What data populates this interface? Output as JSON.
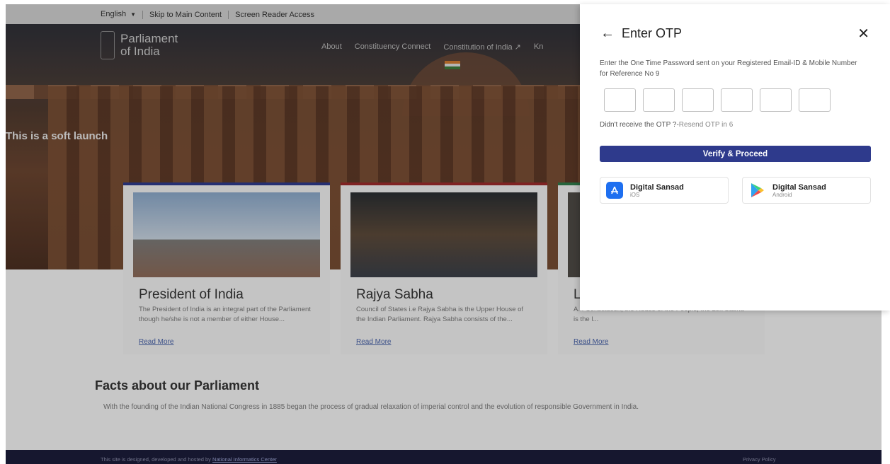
{
  "topbar": {
    "language": "English",
    "skip": "Skip to Main Content",
    "screen_reader": "Screen Reader Access"
  },
  "logo": {
    "line1": "Parliament",
    "line2": "of India"
  },
  "nav": {
    "items": [
      "About",
      "Constituency Connect",
      "Constitution of India",
      "Kn"
    ]
  },
  "hero": {
    "banner": "This is a soft launch"
  },
  "cards": [
    {
      "title": "President of India",
      "desc": "The President of India is an integral part of the Parliament though he/she is not a member of either House...",
      "link": "Read More",
      "accent": "#2e3a8c"
    },
    {
      "title": "Rajya Sabha",
      "desc": "Council of States i.e Rajya Sabha is the Upper House of the Indian Parliament. Rajya Sabha consists of the...",
      "link": "Read More",
      "accent": "#9c2b2b"
    },
    {
      "title": "L",
      "desc": "A... Constitution, the House of the People, the Lok Sabha is the l...",
      "link": "Read More",
      "accent": "#2f7a4a"
    }
  ],
  "facts": {
    "title": "Facts about our Parliament",
    "text": "With the founding of the Indian National Congress in 1885 began the process of gradual relaxation of imperial control and the evolution of responsible Government in India."
  },
  "footer": {
    "left_prefix": "This site is designed, developed and hosted by",
    "left_link": "National Informatics Center",
    "right": "Privacy Policy"
  },
  "modal": {
    "title": "Enter OTP",
    "description": "Enter the One Time Password sent on your Registered Email-ID & Mobile Number for Reference No 9",
    "resend_prefix": "Didn't receive the OTP ?-",
    "resend_timer": "Resend OTP in 6",
    "verify_label": "Verify & Proceed",
    "apps": [
      {
        "name": "Digital Sansad",
        "platform": "iOS",
        "icon": "app-store-icon"
      },
      {
        "name": "Digital Sansad",
        "platform": "Android",
        "icon": "google-play-icon"
      }
    ],
    "colors": {
      "primary": "#2e3a8c"
    }
  }
}
